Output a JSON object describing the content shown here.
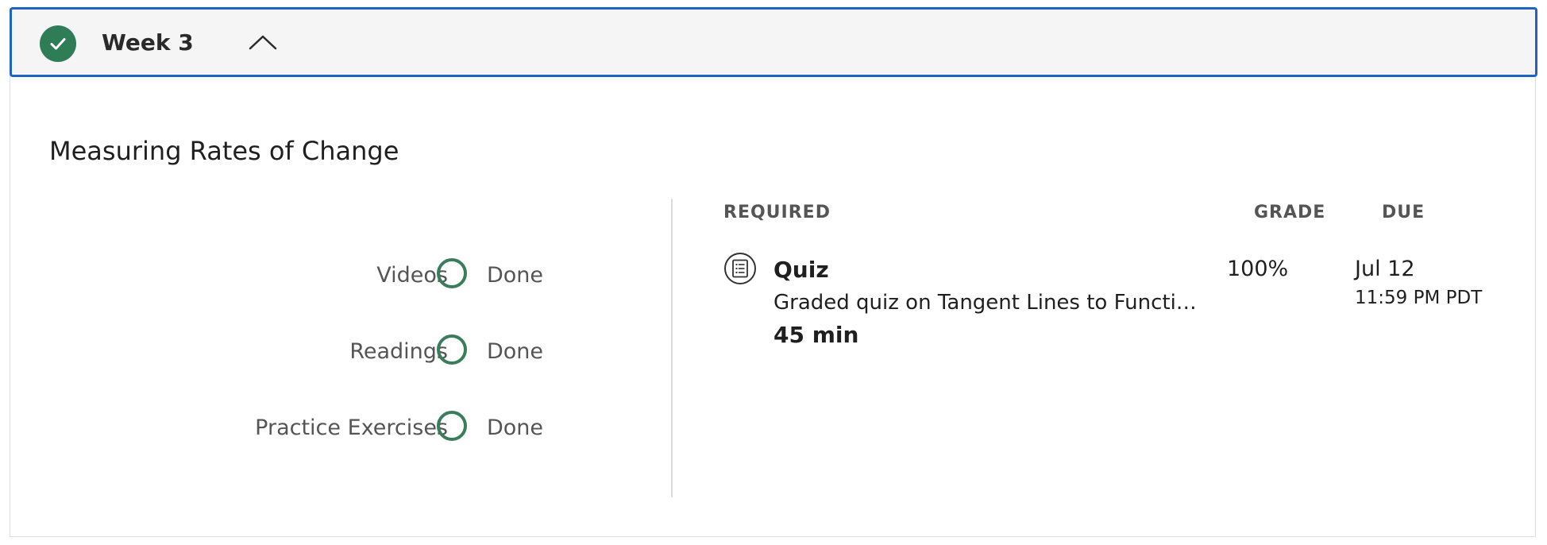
{
  "week": {
    "title": "Week 3",
    "completed": true,
    "expanded": true
  },
  "module": {
    "title": "Measuring Rates of Change"
  },
  "progress": [
    {
      "label": "Videos",
      "status": "Done"
    },
    {
      "label": "Readings",
      "status": "Done"
    },
    {
      "label": "Practice Exercises",
      "status": "Done"
    }
  ],
  "columns": {
    "required": "REQUIRED",
    "grade": "GRADE",
    "due": "DUE"
  },
  "items": [
    {
      "icon": "quiz-icon",
      "type": "Quiz",
      "description": "Graded quiz on Tangent Lines to Functio…",
      "duration": "45 min",
      "grade": "100%",
      "due_date": "Jul 12",
      "due_time": "11:59 PM PDT"
    }
  ],
  "colors": {
    "accent_border": "#1f63c5",
    "success": "#2f7d57",
    "muted_text": "#555555"
  }
}
